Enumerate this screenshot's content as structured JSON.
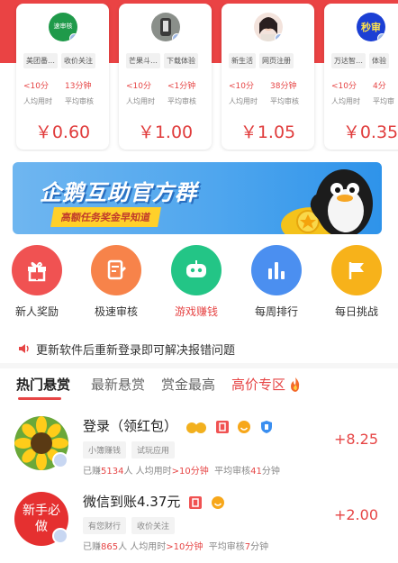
{
  "cards": [
    {
      "logo_text": "速审核",
      "tags": [
        "美团番…",
        "收价关注"
      ],
      "time_avg": "<10分",
      "time_avg_label": "人均用时",
      "review": "13分钟",
      "review_label": "平均审核",
      "price": "￥0.60"
    },
    {
      "logo_text": "",
      "tags": [
        "芒果斗…",
        "下载体验"
      ],
      "time_avg": "<10分",
      "time_avg_label": "人均用时",
      "review": "<1分钟",
      "review_label": "平均审核",
      "price": "￥1.00"
    },
    {
      "logo_text": "",
      "tags": [
        "新生活",
        "网页注册"
      ],
      "time_avg": "<10分",
      "time_avg_label": "人均用时",
      "review": "38分钟",
      "review_label": "平均审核",
      "price": "￥1.05"
    },
    {
      "logo_text": "秒审",
      "tags": [
        "万达智…",
        "体验"
      ],
      "time_avg": "<10分",
      "time_avg_label": "人均用时",
      "review": "4分",
      "review_label": "平均审",
      "price": "￥0.35"
    }
  ],
  "banner": {
    "title": "企鹅互助官方群",
    "subtitle": "高额任务奖金早知道"
  },
  "entries": [
    {
      "label": "新人奖励",
      "icon": "gift-icon",
      "color": "#f05252"
    },
    {
      "label": "极速审核",
      "icon": "document-icon",
      "color": "#f7834a"
    },
    {
      "label": "游戏赚钱",
      "icon": "gamepad-icon",
      "color": "#23c586"
    },
    {
      "label": "每周排行",
      "icon": "bar-chart-icon",
      "color": "#4b8ff0"
    },
    {
      "label": "每日挑战",
      "icon": "flag-icon",
      "color": "#f7b21a"
    }
  ],
  "notice": {
    "text": "更新软件后重新登录即可解决报错问题"
  },
  "tabs": [
    "热门悬赏",
    "最新悬赏",
    "赏金最高",
    "高价专区"
  ],
  "tasks": [
    {
      "name": "登录（领红包）",
      "tags": [
        "小簿赚钱",
        "试玩应用"
      ],
      "earned_prefix": "已赚",
      "earned_count": "5134",
      "earned_suffix": "人 人均用时",
      "avg_time": ">10分钟",
      "review_prefix": "平均审核",
      "review_time": "41",
      "review_suffix": "分钟",
      "reward": "+8.25",
      "avatar_text": ""
    },
    {
      "name": "微信到账4.37元",
      "tags": [
        "有您财行",
        "收价关注"
      ],
      "earned_prefix": "已赚",
      "earned_count": "865",
      "earned_suffix": "人 人均用时",
      "avg_time": ">10分钟",
      "review_prefix": "平均审核",
      "review_time": "7",
      "review_suffix": "分钟",
      "reward": "+2.00",
      "avatar_text": "新手必做"
    }
  ],
  "colors": {
    "brand_red": "#ea4344",
    "price_red": "#e03c3c",
    "banner_blue": "#4fa6ee"
  }
}
